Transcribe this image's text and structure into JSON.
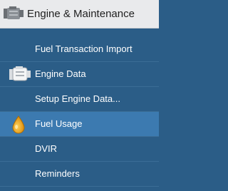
{
  "header": {
    "title": "Engine & Maintenance",
    "icon": "engine-icon"
  },
  "menu": {
    "items": [
      {
        "label": "Fuel Transaction Import",
        "icon": null,
        "selected": false
      },
      {
        "label": "Engine Data",
        "icon": "engine-icon",
        "selected": false
      },
      {
        "label": "Setup Engine Data...",
        "icon": null,
        "selected": false
      },
      {
        "label": "Fuel Usage",
        "icon": "fuel-drop-icon",
        "selected": true
      },
      {
        "label": "DVIR",
        "icon": null,
        "selected": false
      },
      {
        "label": "Reminders",
        "icon": null,
        "selected": false
      }
    ]
  },
  "colors": {
    "panel": "#2b5d87",
    "selected": "#3c7ab0",
    "header": "#e9eaec",
    "fuel_drop": "#e4a316"
  }
}
